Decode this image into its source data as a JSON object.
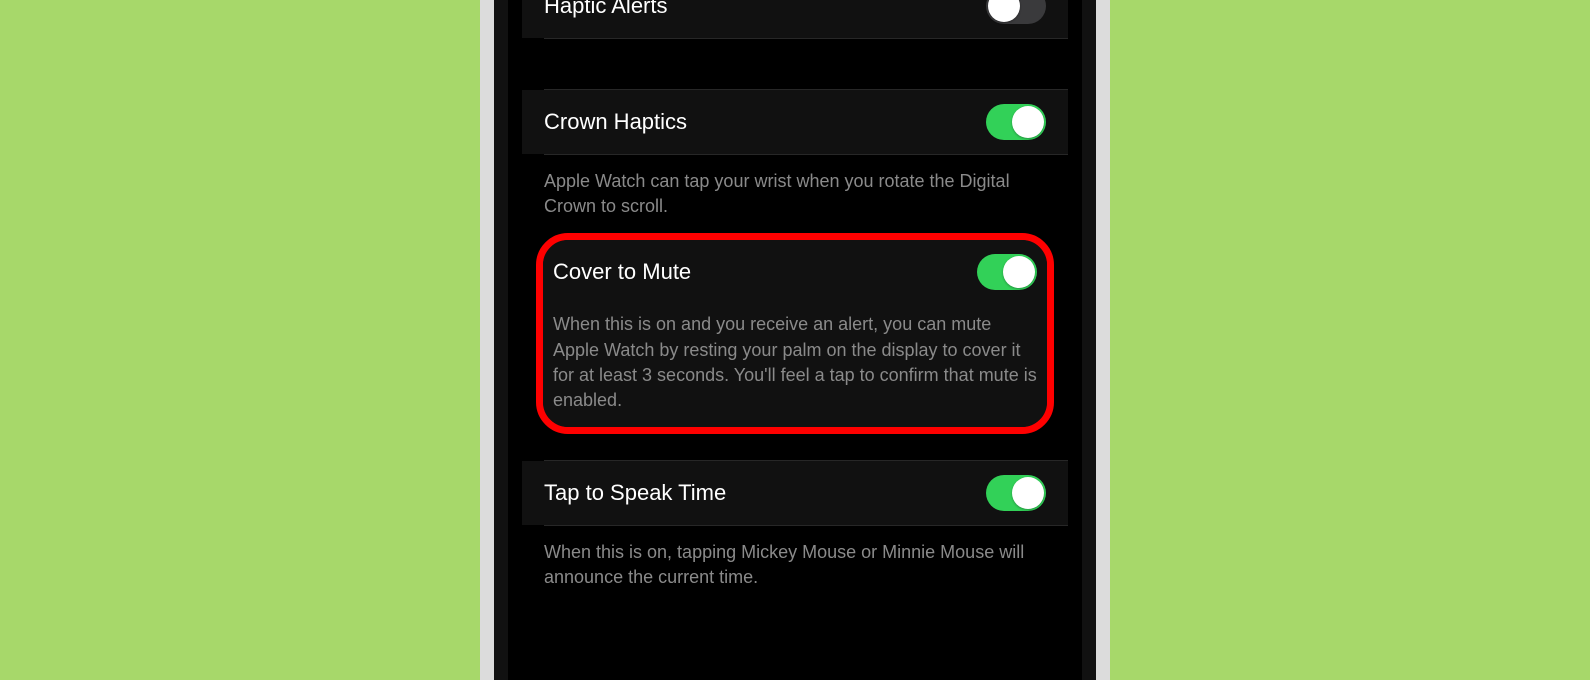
{
  "settings": {
    "haptic_alerts": {
      "label": "Haptic Alerts",
      "on": false
    },
    "crown_haptics": {
      "label": "Crown Haptics",
      "on": true,
      "desc": "Apple Watch can tap your wrist when you rotate the Digital Crown to scroll."
    },
    "cover_to_mute": {
      "label": "Cover to Mute",
      "on": true,
      "desc": "When this is on and you receive an alert, you can mute Apple Watch by resting your palm on the display to cover it for at least 3 seconds. You'll feel a tap to confirm that mute is enabled."
    },
    "tap_to_speak": {
      "label": "Tap to Speak Time",
      "on": true,
      "desc": "When this is on, tapping Mickey Mouse or Minnie Mouse will announce the current time."
    }
  },
  "colors": {
    "background": "#a7d86a",
    "callout_border": "#ff0000",
    "toggle_on": "#32d158"
  }
}
